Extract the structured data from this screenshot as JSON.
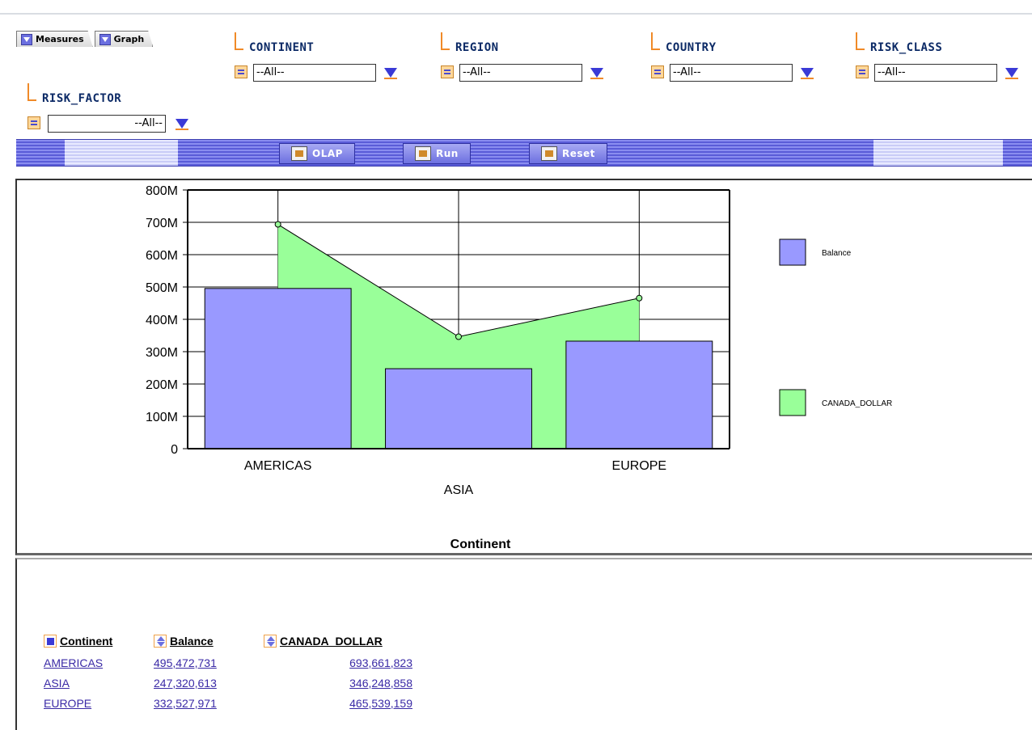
{
  "tabs": [
    {
      "label": "Measures",
      "icon": "dropdown-arrow-icon"
    },
    {
      "label": "Graph",
      "icon": "dropdown-arrow-icon"
    }
  ],
  "filters": [
    {
      "label": "CONTINENT",
      "value": "--All--"
    },
    {
      "label": "REGION",
      "value": "--All--"
    },
    {
      "label": "COUNTRY",
      "value": "--All--"
    },
    {
      "label": "RISK_CLASS",
      "value": "--All--"
    },
    {
      "label": "RISK_FACTOR",
      "value": "--All--"
    }
  ],
  "toolbar": {
    "olap_label": "OLAP",
    "run_label": "Run",
    "reset_label": "Reset"
  },
  "colors": {
    "balance": "#9999ff",
    "canada_dollar": "#99ff99",
    "band": "#6b6fe0",
    "link": "#3a2aa6"
  },
  "chart_data": {
    "type": "bar",
    "categories": [
      "AMERICAS",
      "ASIA",
      "EUROPE"
    ],
    "series": [
      {
        "name": "Balance",
        "type": "bar",
        "values": [
          495472731,
          247320613,
          332527971
        ]
      },
      {
        "name": "CANADA_DOLLAR",
        "type": "area",
        "values": [
          693661823,
          346248858,
          465539159
        ]
      }
    ],
    "ytick_labels": [
      "0",
      "100M",
      "200M",
      "300M",
      "400M",
      "500M",
      "600M",
      "700M",
      "800M"
    ],
    "ylim": [
      0,
      800000000
    ],
    "xlabel": "Continent",
    "ylabel": "",
    "grid": true,
    "legend_placement": "right"
  },
  "table": {
    "columns": [
      "Continent",
      "Balance",
      "CANADA_DOLLAR"
    ],
    "rows": [
      [
        "AMERICAS",
        "495,472,731",
        "693,661,823"
      ],
      [
        "ASIA",
        "247,320,613",
        "346,248,858"
      ],
      [
        "EUROPE",
        "332,527,971",
        "465,539,159"
      ]
    ]
  }
}
